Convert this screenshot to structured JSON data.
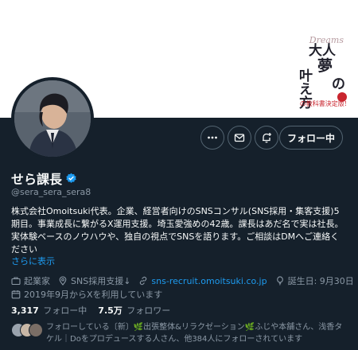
{
  "banner": {
    "book_script": "Dreams",
    "book_char_1": "大人",
    "book_char_2": "夢",
    "book_char_3": "の",
    "book_char_4": "叶え方",
    "book_tagline": "の教科書決定版!"
  },
  "profile": {
    "name": "せら課長",
    "handle": "@sera_sera_sera8",
    "bio": "株式会社Omoitsuki代表。企業、経営者向けのSNSコンサル(SNS採用・集客支援)5期目。事業成長に繋がるX運用支援。埼玉愛強めの42歳。課長はあだ名で実は社長。実体験ベースのノウハウや、独自の視点でSNSを語ります。ご相談はDMへご連絡ください",
    "show_more": "さらに表示"
  },
  "actions": {
    "follow_label": "フォロー中"
  },
  "meta": {
    "category": "起業家",
    "location": "SNS採用支援↓",
    "url": "sns-recruit.omoitsuki.co.jp",
    "birthday": "誕生日: 9月30日",
    "joined": "2019年9月からXを利用しています"
  },
  "stats": {
    "following_count": "3,317",
    "following_label": "フォロー中",
    "followers_count": "7.5万",
    "followers_label": "フォロワー"
  },
  "followed_by": "フォローしている〔新〕🌿出張整体&リラクゼーション🌿ふじや本舗さん、浅香タケル｜Doをプロデュースする人さん、他384人にフォローされています",
  "colors": {
    "background": "#15202b",
    "accent": "#1d9bf0",
    "text": "#f7f9f9",
    "secondary_text": "#8b98a5",
    "button_border": "#536471"
  }
}
